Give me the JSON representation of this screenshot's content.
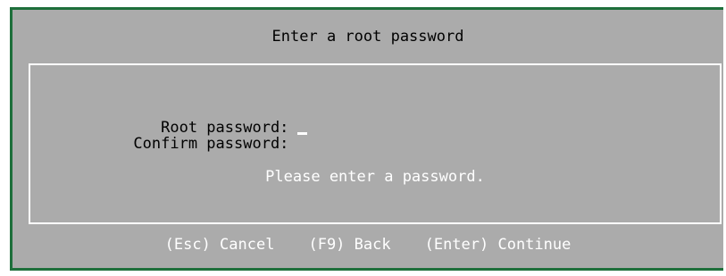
{
  "dialog": {
    "title": "Enter a root password",
    "fields": [
      {
        "label": "Root password:",
        "value": "",
        "has_cursor": true
      },
      {
        "label": "Confirm password:",
        "value": "",
        "has_cursor": false
      }
    ],
    "status_message": "Please enter a password."
  },
  "footer": {
    "cancel_label": "(Esc) Cancel",
    "back_label": "(F9) Back",
    "continue_label": "(Enter) Continue"
  },
  "colors": {
    "dialog_background": "#ababab",
    "frame": "#1e6f3b",
    "highlight_text": "#ffffff",
    "text": "#000000"
  }
}
